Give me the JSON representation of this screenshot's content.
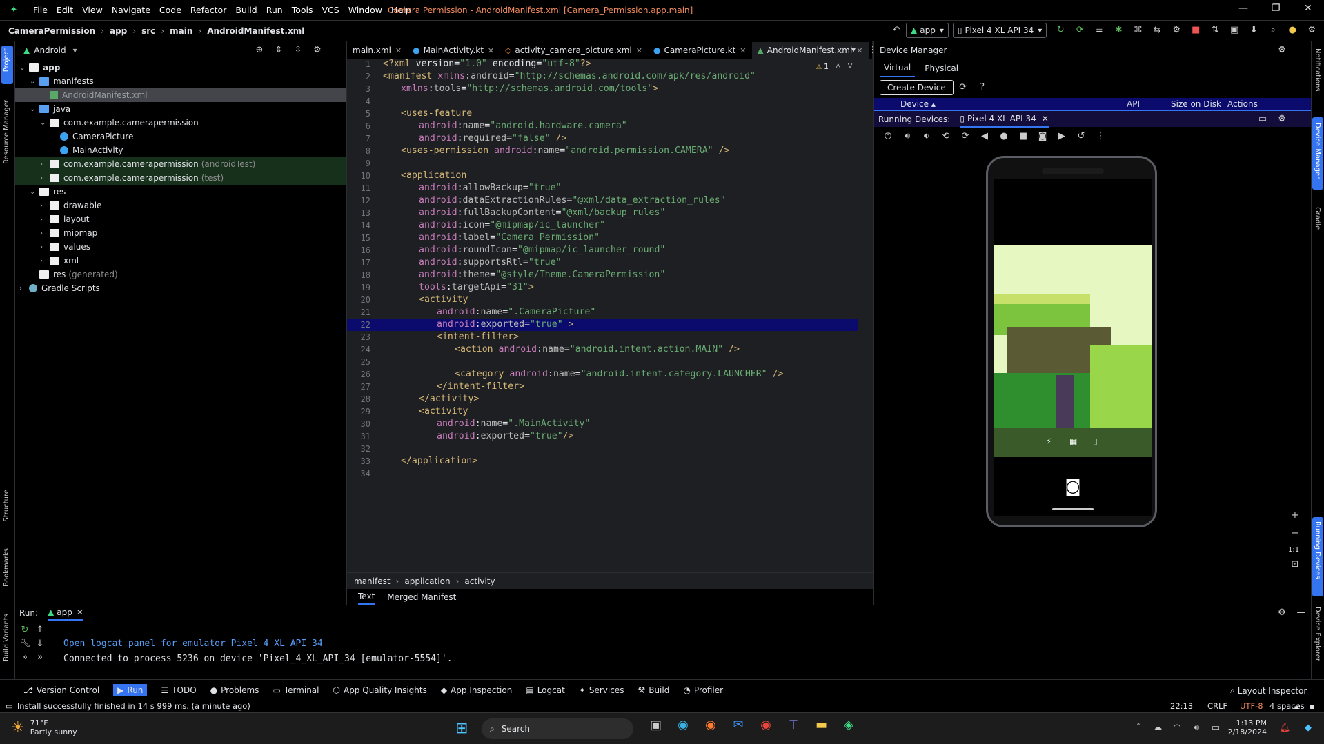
{
  "menu": [
    "File",
    "Edit",
    "View",
    "Navigate",
    "Code",
    "Refactor",
    "Build",
    "Run",
    "Tools",
    "VCS",
    "Window",
    "Help"
  ],
  "window_title": "Camera Permission - AndroidManifest.xml [Camera_Permission.app.main]",
  "breadcrumbs": [
    "CameraPermission",
    "app",
    "src",
    "main",
    "AndroidManifest.xml"
  ],
  "toolbar": {
    "config": "app",
    "device": "Pixel 4 XL API 34"
  },
  "project": {
    "view": "Android",
    "rows": [
      {
        "indent": 0,
        "arrow": "down",
        "icon": "folder",
        "label": "app",
        "bold": true
      },
      {
        "indent": 1,
        "arrow": "down",
        "icon": "folder-blue",
        "label": "manifests"
      },
      {
        "indent": 2,
        "arrow": "",
        "icon": "manifest",
        "label": "AndroidManifest.xml",
        "selected": true
      },
      {
        "indent": 1,
        "arrow": "down",
        "icon": "folder-blue",
        "label": "java"
      },
      {
        "indent": 2,
        "arrow": "down",
        "icon": "folder",
        "label": "com.example.camerapermission"
      },
      {
        "indent": 3,
        "arrow": "",
        "icon": "kotlin",
        "label": "CameraPicture"
      },
      {
        "indent": 3,
        "arrow": "",
        "icon": "kotlin",
        "label": "MainActivity"
      },
      {
        "indent": 2,
        "arrow": "right",
        "icon": "folder",
        "label": "com.example.camerapermission",
        "suffix": "(androidTest)",
        "hl": true
      },
      {
        "indent": 2,
        "arrow": "right",
        "icon": "folder",
        "label": "com.example.camerapermission",
        "suffix": "(test)",
        "hl": true
      },
      {
        "indent": 1,
        "arrow": "down",
        "icon": "folder",
        "label": "res"
      },
      {
        "indent": 2,
        "arrow": "right",
        "icon": "folder",
        "label": "drawable"
      },
      {
        "indent": 2,
        "arrow": "right",
        "icon": "folder",
        "label": "layout"
      },
      {
        "indent": 2,
        "arrow": "right",
        "icon": "folder",
        "label": "mipmap"
      },
      {
        "indent": 2,
        "arrow": "right",
        "icon": "folder",
        "label": "values"
      },
      {
        "indent": 2,
        "arrow": "right",
        "icon": "folder",
        "label": "xml"
      },
      {
        "indent": 1,
        "arrow": "",
        "icon": "folder",
        "label": "res",
        "suffix": "(generated)"
      },
      {
        "indent": 0,
        "arrow": "right",
        "icon": "gradle",
        "label": "Gradle Scripts"
      }
    ]
  },
  "left_stripe": [
    "Project",
    "Resource Manager",
    "Structure",
    "Bookmarks",
    "Build Variants"
  ],
  "right_stripe": [
    "Notifications",
    "Device Manager",
    "Gradle",
    "Running Devices",
    "Device Explorer"
  ],
  "editor": {
    "tabs": [
      {
        "label": "main.xml",
        "icon": "xml"
      },
      {
        "label": "MainActivity.kt",
        "icon": "kotlin"
      },
      {
        "label": "activity_camera_picture.xml",
        "icon": "xml"
      },
      {
        "label": "CameraPicture.kt",
        "icon": "kotlin"
      },
      {
        "label": "AndroidManifest.xml",
        "icon": "manifest",
        "active": true
      }
    ],
    "warning_count": "1",
    "lines": [
      {
        "n": "1",
        "indent": 0,
        "code": "<?xml version=\"1.0\" encoding=\"utf-8\"?>"
      },
      {
        "n": "2",
        "indent": 0,
        "code": "<manifest xmlns:android=\"http://schemas.android.com/apk/res/android\""
      },
      {
        "n": "3",
        "indent": 1,
        "code": "xmlns:tools=\"http://schemas.android.com/tools\">"
      },
      {
        "n": "4",
        "indent": 0,
        "code": ""
      },
      {
        "n": "5",
        "indent": 1,
        "code": "<uses-feature"
      },
      {
        "n": "6",
        "indent": 2,
        "code": "android:name=\"android.hardware.camera\""
      },
      {
        "n": "7",
        "indent": 2,
        "code": "android:required=\"false\" />"
      },
      {
        "n": "8",
        "indent": 1,
        "code": "<uses-permission android:name=\"android.permission.CAMERA\" />"
      },
      {
        "n": "9",
        "indent": 0,
        "code": ""
      },
      {
        "n": "10",
        "indent": 1,
        "code": "<application"
      },
      {
        "n": "11",
        "indent": 2,
        "code": "android:allowBackup=\"true\""
      },
      {
        "n": "12",
        "indent": 2,
        "code": "android:dataExtractionRules=\"@xml/data_extraction_rules\""
      },
      {
        "n": "13",
        "indent": 2,
        "code": "android:fullBackupContent=\"@xml/backup_rules\""
      },
      {
        "n": "14",
        "indent": 2,
        "code": "android:icon=\"@mipmap/ic_launcher\""
      },
      {
        "n": "15",
        "indent": 2,
        "code": "android:label=\"Camera Permission\""
      },
      {
        "n": "16",
        "indent": 2,
        "code": "android:roundIcon=\"@mipmap/ic_launcher_round\""
      },
      {
        "n": "17",
        "indent": 2,
        "code": "android:supportsRtl=\"true\""
      },
      {
        "n": "18",
        "indent": 2,
        "code": "android:theme=\"@style/Theme.CameraPermission\""
      },
      {
        "n": "19",
        "indent": 2,
        "code": "tools:targetApi=\"31\">"
      },
      {
        "n": "20",
        "indent": 2,
        "code": "<activity"
      },
      {
        "n": "21",
        "indent": 3,
        "code": "android:name=\".CameraPicture\""
      },
      {
        "n": "22",
        "indent": 3,
        "code": "android:exported=\"true\" >",
        "selected": true
      },
      {
        "n": "23",
        "indent": 3,
        "code": "<intent-filter>"
      },
      {
        "n": "24",
        "indent": 4,
        "code": "<action android:name=\"android.intent.action.MAIN\" />"
      },
      {
        "n": "25",
        "indent": 0,
        "code": ""
      },
      {
        "n": "26",
        "indent": 4,
        "code": "<category android:name=\"android.intent.category.LAUNCHER\" />"
      },
      {
        "n": "27",
        "indent": 3,
        "code": "</intent-filter>"
      },
      {
        "n": "28",
        "indent": 2,
        "code": "</activity>"
      },
      {
        "n": "29",
        "indent": 2,
        "code": "<activity"
      },
      {
        "n": "30",
        "indent": 3,
        "code": "android:name=\".MainActivity\""
      },
      {
        "n": "31",
        "indent": 3,
        "code": "android:exported=\"true\"/>"
      },
      {
        "n": "32",
        "indent": 0,
        "code": ""
      },
      {
        "n": "33",
        "indent": 1,
        "code": "</application>"
      },
      {
        "n": "34",
        "indent": 0,
        "code": ""
      }
    ],
    "breadcrumb": [
      "manifest",
      "application",
      "activity"
    ],
    "bottom_tabs": [
      "Text",
      "Merged Manifest"
    ]
  },
  "device_manager": {
    "title": "Device Manager",
    "tabs": [
      "Virtual",
      "Physical"
    ],
    "create_button": "Create Device",
    "columns": [
      "Device",
      "API",
      "Size on Disk",
      "Actions"
    ],
    "running_label": "Running Devices:",
    "running_tab": "Pixel 4 XL API 34",
    "zoom_label": "1:1"
  },
  "run": {
    "label": "Run:",
    "tab": "app",
    "link": "Open logcat panel for emulator Pixel 4 XL API 34",
    "message": "Connected to process 5236 on device 'Pixel_4_XL_API_34 [emulator-5554]'."
  },
  "tool_windows": [
    "Version Control",
    "Run",
    "TODO",
    "Problems",
    "Terminal",
    "App Quality Insights",
    "App Inspection",
    "Logcat",
    "Services",
    "Build",
    "Profiler"
  ],
  "layout_inspector": "Layout Inspector",
  "status": {
    "message": "Install successfully finished in 14 s 999 ms. (a minute ago)",
    "position": "22:13",
    "line_sep": "CRLF",
    "encoding": "UTF-8",
    "indent": "4 spaces"
  },
  "taskbar": {
    "temp": "71°F",
    "weather": "Partly sunny",
    "search": "Search",
    "time": "1:13 PM",
    "date": "2/18/2024"
  },
  "colors": {
    "accent": "#3574f0",
    "title": "#f08a5d",
    "string": "#6aab73",
    "tag": "#d5b778",
    "ns": "#c77dbb",
    "selection": "#0b0b6e"
  }
}
